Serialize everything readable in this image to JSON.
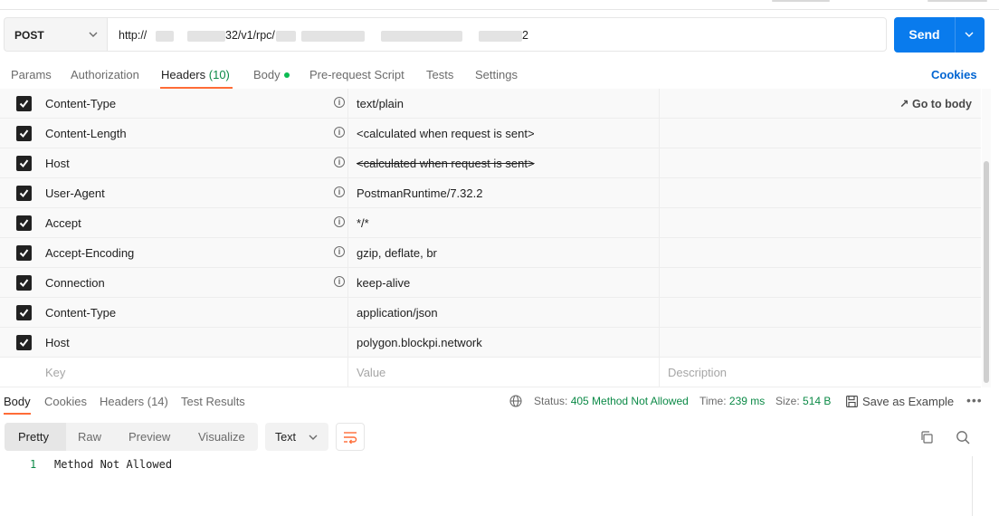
{
  "request": {
    "method": "POST",
    "url_visible_parts": [
      "http://",
      "32/v1/rpc/",
      "2"
    ],
    "send_label": "Send"
  },
  "request_tabs": [
    {
      "label": "Params"
    },
    {
      "label": "Authorization"
    },
    {
      "label": "Headers",
      "count": "(10)"
    },
    {
      "label": "Body"
    },
    {
      "label": "Pre-request Script"
    },
    {
      "label": "Tests"
    },
    {
      "label": "Settings"
    }
  ],
  "cookies_label": "Cookies",
  "go_to_body": "Go to body",
  "headers": [
    {
      "key": "Content-Type",
      "value": "text/plain",
      "auto": true
    },
    {
      "key": "Content-Length",
      "value": "<calculated when request is sent>",
      "auto": true
    },
    {
      "key": "Host",
      "value": "<calculated when request is sent>",
      "auto": true,
      "overridden": true
    },
    {
      "key": "User-Agent",
      "value": "PostmanRuntime/7.32.2",
      "auto": true
    },
    {
      "key": "Accept",
      "value": "*/*",
      "auto": true
    },
    {
      "key": "Accept-Encoding",
      "value": "gzip, deflate, br",
      "auto": true
    },
    {
      "key": "Connection",
      "value": "keep-alive",
      "auto": true
    },
    {
      "key": "Content-Type",
      "value": "application/json",
      "auto": false
    },
    {
      "key": "Host",
      "value": "polygon.blockpi.network",
      "auto": false
    }
  ],
  "new_row": {
    "key_placeholder": "Key",
    "value_placeholder": "Value",
    "description_placeholder": "Description"
  },
  "response": {
    "tabs": [
      {
        "label": "Body"
      },
      {
        "label": "Cookies"
      },
      {
        "label": "Headers (14)"
      },
      {
        "label": "Test Results"
      }
    ],
    "status_label": "Status:",
    "status_value": "405 Method Not Allowed",
    "time_label": "Time:",
    "time_value": "239 ms",
    "size_label": "Size:",
    "size_value": "514 B",
    "save_label": "Save as Example",
    "more_label": "•••",
    "views": [
      "Pretty",
      "Raw",
      "Preview",
      "Visualize"
    ],
    "format": "Text",
    "line_number": "1",
    "body_text": "Method Not Allowed"
  },
  "colors": {
    "accent": "#097bed",
    "orange": "#ff6c37",
    "green": "#0c8a47"
  }
}
